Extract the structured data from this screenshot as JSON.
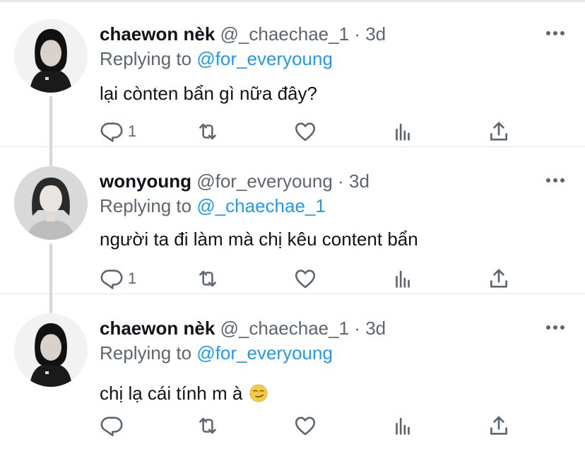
{
  "tweets": [
    {
      "name": "chaewon nèk",
      "handle": "@_chaechae_1",
      "separator": "·",
      "time": "3d",
      "replying_prefix": "Replying to",
      "replying_to": "@for_everyoung",
      "text": "lại cònten bẩn gì nữa đây?",
      "reply_count": "1",
      "icons": [
        "reply-icon",
        "retweet-icon",
        "like-icon",
        "analytics-icon",
        "share-icon",
        "more-icon"
      ]
    },
    {
      "name": "wonyoung",
      "handle": "@for_everyoung",
      "separator": "·",
      "time": "3d",
      "replying_prefix": "Replying to",
      "replying_to": "@_chaechae_1",
      "text": "người ta đi làm mà chị kêu content bẩn",
      "reply_count": "1",
      "icons": [
        "reply-icon",
        "retweet-icon",
        "like-icon",
        "analytics-icon",
        "share-icon",
        "more-icon"
      ]
    },
    {
      "name": "chaewon nèk",
      "handle": "@_chaechae_1",
      "separator": "·",
      "time": "3d",
      "replying_prefix": "Replying to",
      "replying_to": "@for_everyoung",
      "text": "chị lạ cái tính m à",
      "emoji": "smirking-face-emoji",
      "reply_count": "",
      "icons": [
        "reply-icon",
        "retweet-icon",
        "like-icon",
        "analytics-icon",
        "share-icon",
        "more-icon"
      ]
    }
  ],
  "colors": {
    "mention": "#1d9bf0",
    "secondary_text": "#5b6670",
    "primary_text": "#0f1419",
    "thread_line": "#cfd9de"
  }
}
